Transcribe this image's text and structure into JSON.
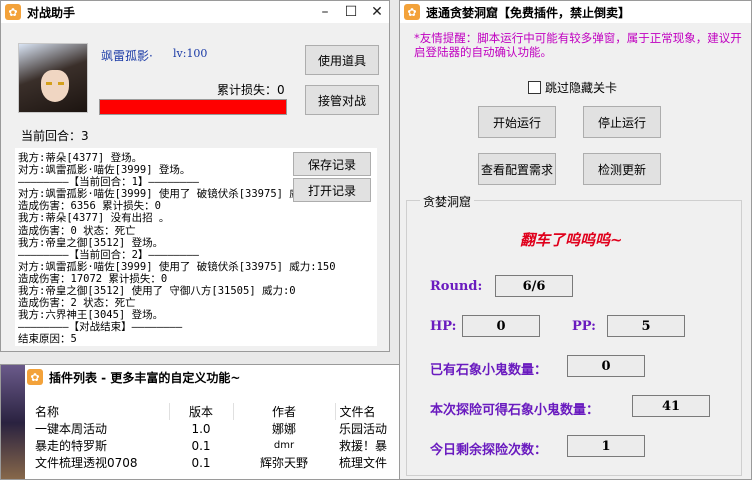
{
  "battle": {
    "title": "对战助手",
    "player_name": "飒雷孤影·",
    "player_level": "lv:100",
    "use_item": "使用道具",
    "takeover": "接管对战",
    "loss_label": "累计损失：0",
    "round_label": "当前回合：3",
    "save_log": "保存记录",
    "open_log": "打开记录",
    "log_lines": [
      "我方:蒂朵[4377] 登场。",
      "对方:飒雷孤影·喵佐[3999] 登场。",
      "————————【当前回合：1】————————",
      "对方:飒雷孤影·喵佐[3999] 使用了 破镜伏杀[33975] 威力:150",
      "造成伤害：6356 累计损失：0",
      "我方:蒂朵[4377] 没有出招 。",
      "造成伤害：0 状态：死亡",
      "我方:帝皇之御[3512] 登场。",
      "————————【当前回合：2】————————",
      "对方:飒雷孤影·喵佐[3999] 使用了 破镜伏杀[33975] 威力:150",
      "造成伤害：17072 累计损失：0",
      "我方:帝皇之御[3512] 使用了 守御八方[31505] 威力:0",
      "造成伤害：2 状态：死亡",
      "我方:六界神王[3045] 登场。",
      "————————【对战结束】————————",
      "结束原因：5"
    ]
  },
  "plugins": {
    "title": "插件列表 - 更多丰富的自定义功能~",
    "columns": [
      "名称",
      "版本",
      "作者",
      "文件名"
    ],
    "rows": [
      [
        "一键本周活动",
        "1.0",
        "娜娜",
        "乐园活动"
      ],
      [
        "暴走的特罗斯",
        "0.1",
        "dmr",
        "救援！暴"
      ],
      [
        "文件梳理透视0708",
        "0.1",
        "辉弥天野",
        "梳理文件"
      ]
    ]
  },
  "cave": {
    "title": "速通贪婪洞窟【免费插件，禁止倒卖】",
    "notice": "*友情提醒：脚本运行中可能有较多弹窗，属于正常现象，建议开启登陆器的自动确认功能。",
    "skip_hidden": "跳过隐藏关卡",
    "start": "开始运行",
    "stop": "停止运行",
    "view_config": "查看配置需求",
    "check_update": "检测更新",
    "group_label": "贪婪洞窟",
    "status": "翻车了呜呜呜~",
    "round_label": "Round:",
    "round_value": "6/6",
    "hp_label": "HP:",
    "hp_value": "0",
    "pp_label": "PP:",
    "pp_value": "5",
    "stone_label": "已有石象小鬼数量：",
    "stone_value": "0",
    "gain_label": "本次探险可得石象小鬼数量：",
    "gain_value": "41",
    "remain_label": "今日剩余探险次数：",
    "remain_value": "1"
  },
  "colors": {
    "accent_red": "#ff0000",
    "label_purple": "#6a1bbf",
    "status_red": "#e0001c"
  }
}
